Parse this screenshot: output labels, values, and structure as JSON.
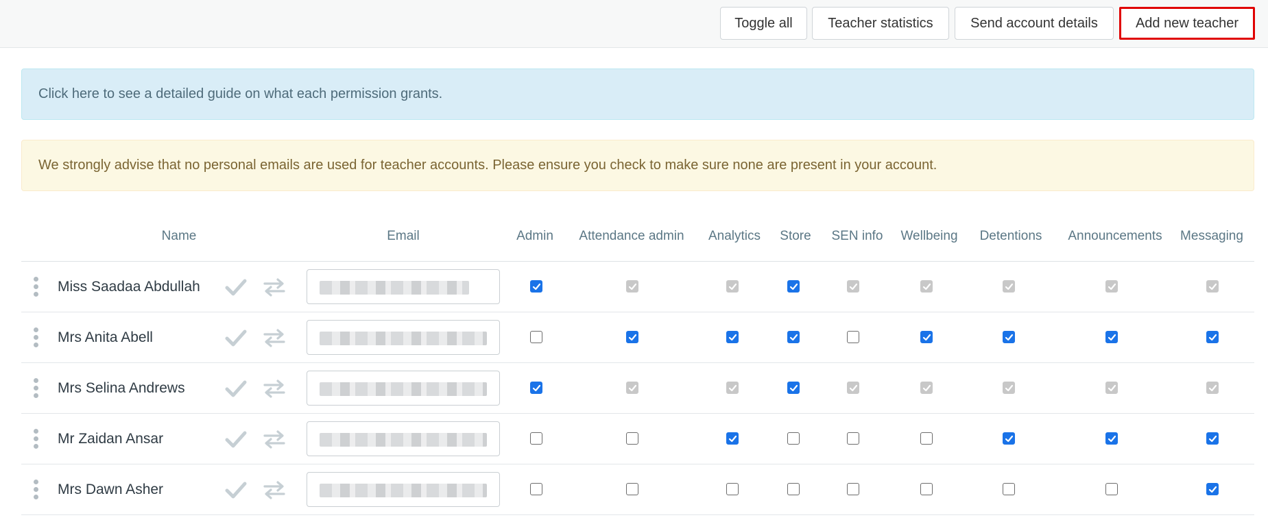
{
  "toolbar": {
    "toggle_all": "Toggle all",
    "teacher_statistics": "Teacher statistics",
    "send_account_details": "Send account details",
    "add_new_teacher": "Add new teacher"
  },
  "alerts": {
    "info": "Click here to see a detailed guide on what each permission grants.",
    "warning": "We strongly advise that no personal emails are used for teacher accounts. Please ensure you check to make sure none are present in your account."
  },
  "table": {
    "columns": {
      "name": "Name",
      "email": "Email",
      "admin": "Admin",
      "attendance_admin": "Attendance admin",
      "analytics": "Analytics",
      "store": "Store",
      "sen_info": "SEN info",
      "wellbeing": "Wellbeing",
      "detentions": "Detentions",
      "announcements": "Announcements",
      "messaging": "Messaging"
    },
    "rows": [
      {
        "name": "Miss Saadaa Abdullah",
        "perms": [
          "on",
          "dis",
          "dis",
          "on",
          "dis",
          "dis",
          "dis",
          "dis",
          "dis"
        ]
      },
      {
        "name": "Mrs Anita Abell",
        "perms": [
          "off",
          "on",
          "on",
          "on",
          "off",
          "on",
          "on",
          "on",
          "on"
        ]
      },
      {
        "name": "Mrs Selina Andrews",
        "perms": [
          "on",
          "dis",
          "dis",
          "on",
          "dis",
          "dis",
          "dis",
          "dis",
          "dis"
        ]
      },
      {
        "name": "Mr Zaidan Ansar",
        "perms": [
          "off",
          "off",
          "on",
          "off",
          "off",
          "off",
          "on",
          "on",
          "on"
        ]
      },
      {
        "name": "Mrs Dawn Asher",
        "perms": [
          "off",
          "off",
          "off",
          "off",
          "off",
          "off",
          "off",
          "off",
          "on"
        ]
      }
    ]
  },
  "icons": {
    "confirm": "check-icon",
    "transfer": "swap-arrows-icon",
    "drag": "drag-handle-icon"
  },
  "colors": {
    "checked": "#1a73e8",
    "disabled": "#c8c8c8",
    "highlight_border": "#e00000"
  }
}
